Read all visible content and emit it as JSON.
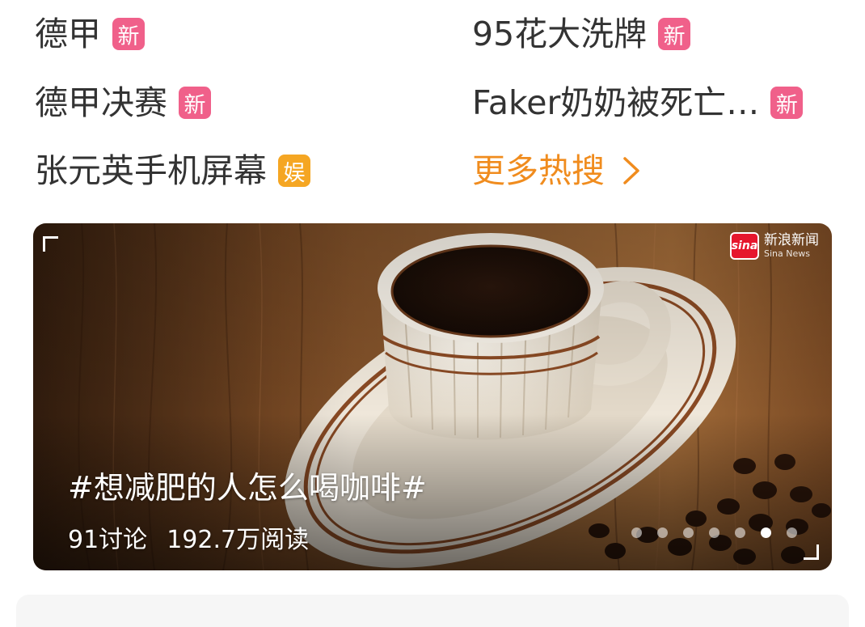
{
  "hot_search": {
    "items": [
      {
        "label": "德甲",
        "badge": "新",
        "badge_color": "#f0608a"
      },
      {
        "label": "95花大洗牌",
        "badge": "新",
        "badge_color": "#f0608a"
      },
      {
        "label": "德甲决赛",
        "badge": "新",
        "badge_color": "#f0608a"
      },
      {
        "label": "Faker奶奶被死亡…",
        "badge": "新",
        "badge_color": "#f0608a"
      },
      {
        "label": "张元英手机屏幕",
        "badge": "娱",
        "badge_color": "#f5a623"
      }
    ],
    "more_label": "更多热搜",
    "more_color": "#f08c1e"
  },
  "topic_card": {
    "source_cn": "新浪新闻",
    "source_en": "Sina News",
    "source_logo": "sina",
    "title": "#想减肥的人怎么喝咖啡#",
    "discussions": "91讨论",
    "reads": "192.7万阅读",
    "carousel": {
      "total": 7,
      "active": 6
    }
  }
}
